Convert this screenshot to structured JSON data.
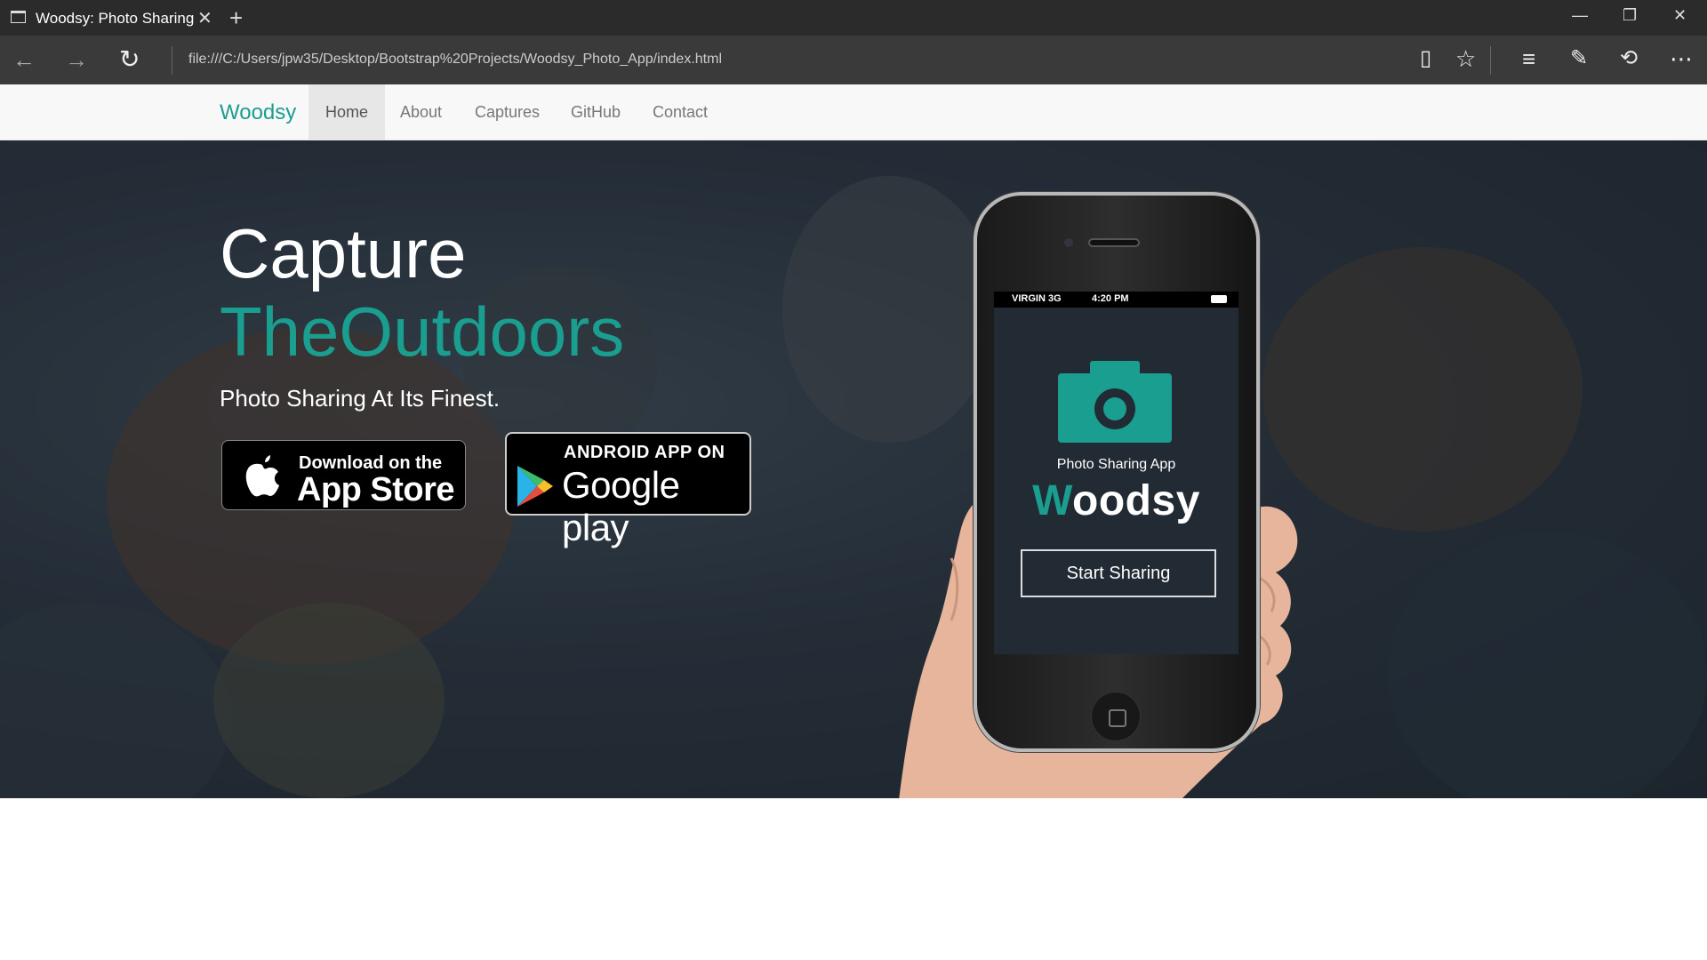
{
  "browser": {
    "tab_title": "Woodsy: Photo Sharing",
    "url": "file:///C:/Users/jpw35/Desktop/Bootstrap%20Projects/Woodsy_Photo_App/index.html"
  },
  "navbar": {
    "brand": "Woodsy",
    "items": [
      "Home",
      "About",
      "Captures",
      "GitHub",
      "Contact"
    ],
    "active": "Home"
  },
  "hero": {
    "line1": "Capture",
    "line2": "TheOutdoors",
    "tagline": "Photo Sharing At Its Finest.",
    "appstore_small": "Download on the",
    "appstore_big": "App Store",
    "google_small": "ANDROID APP ON",
    "google_big": "Google play"
  },
  "phone": {
    "carrier": "VIRGIN 3G",
    "time": "4:20 PM",
    "label": "Photo Sharing App",
    "brand_first": "W",
    "brand_rest": "oodsy",
    "button": "Start Sharing"
  },
  "colors": {
    "accent": "#1a9e8f",
    "chrome": "#2b2b2b",
    "navbar_bg": "#f8f8f8"
  }
}
